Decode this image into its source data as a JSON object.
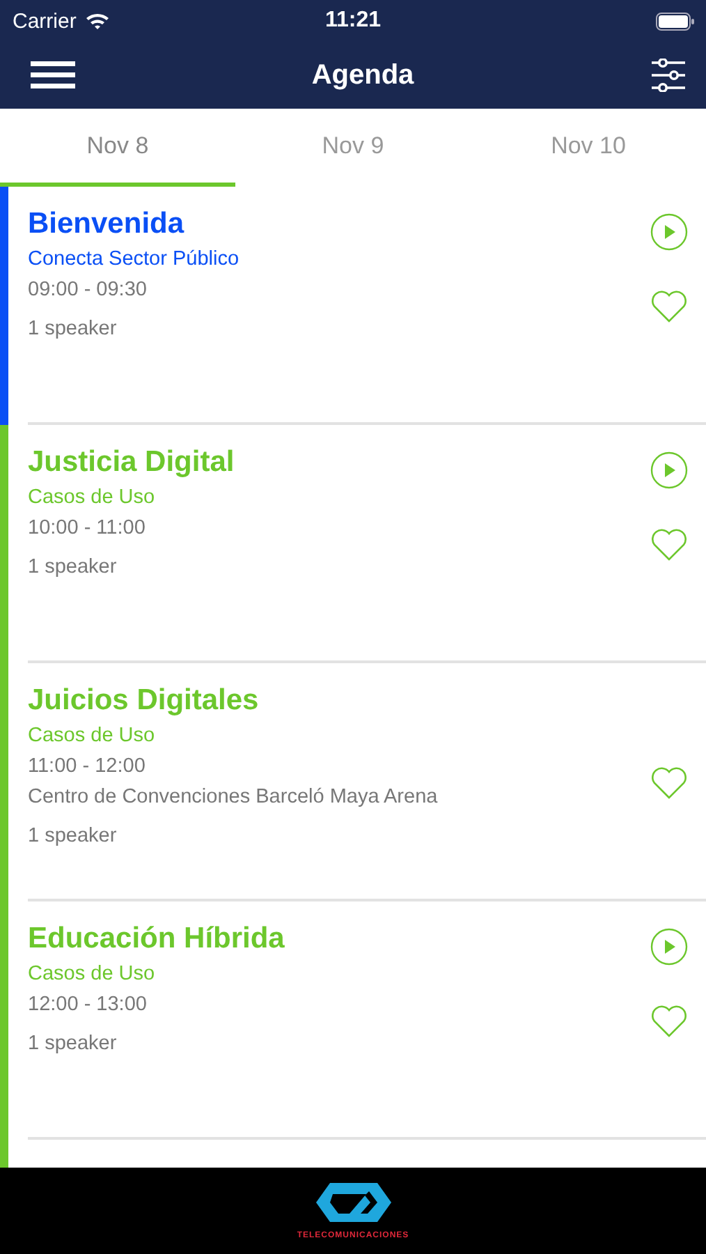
{
  "status_bar": {
    "carrier": "Carrier",
    "time": "11:21"
  },
  "nav": {
    "title": "Agenda"
  },
  "tabs": [
    {
      "label": "Nov 8",
      "selected": true
    },
    {
      "label": "Nov 9",
      "selected": false
    },
    {
      "label": "Nov 10",
      "selected": false
    }
  ],
  "sessions": [
    {
      "title": "Bienvenida",
      "track": "Conecta Sector Público",
      "time": "09:00 - 09:30",
      "speakers": "1 speaker",
      "color": "#0a4ff5",
      "has_video": true,
      "favorite": false
    },
    {
      "title": "Justicia Digital",
      "track": "Casos de Uso",
      "time": "10:00 - 11:00",
      "speakers": "1 speaker",
      "color": "#6cc72c",
      "has_video": true,
      "favorite": false
    },
    {
      "title": "Juicios Digitales",
      "track": "Casos de Uso",
      "time": "11:00 - 12:00",
      "location": "Centro de Convenciones Barceló Maya Arena",
      "speakers": "1 speaker",
      "color": "#6cc72c",
      "has_video": false,
      "favorite": false
    },
    {
      "title": "Educación Híbrida",
      "track": "Casos de Uso",
      "time": "12:00 - 13:00",
      "speakers": "1 speaker",
      "color": "#6cc72c",
      "has_video": true,
      "favorite": false
    }
  ],
  "footer": {
    "brand": "TELECOMUNICACIONES"
  }
}
